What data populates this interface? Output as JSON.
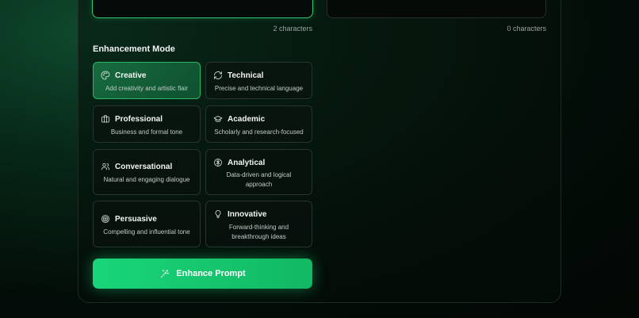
{
  "input": {
    "char_count": "2 characters"
  },
  "output": {
    "char_count": "0 characters"
  },
  "enhancement": {
    "title": "Enhancement Mode",
    "modes": [
      {
        "label": "Creative",
        "desc": "Add creativity and artistic flair",
        "icon": "palette-icon",
        "selected": true
      },
      {
        "label": "Technical",
        "desc": "Precise and technical language",
        "icon": "refresh-icon"
      },
      {
        "label": "Professional",
        "desc": "Business and formal tone",
        "icon": "briefcase-icon"
      },
      {
        "label": "Academic",
        "desc": "Scholarly and research-focused",
        "icon": "graduation-cap-icon"
      },
      {
        "label": "Conversational",
        "desc": "Natural and engaging dialogue",
        "icon": "users-icon"
      },
      {
        "label": "Analytical",
        "desc": "Data-driven and logical approach",
        "icon": "brain-icon"
      },
      {
        "label": "Persuasive",
        "desc": "Compelling and influential tone",
        "icon": "target-icon"
      },
      {
        "label": "Innovative",
        "desc": "Forward-thinking and breakthrough ideas",
        "icon": "lightbulb-icon"
      }
    ]
  },
  "actions": {
    "enhance_label": "Enhance Prompt"
  },
  "colors": {
    "accent": "#19d57a",
    "selected_bg": "#176b3f"
  }
}
